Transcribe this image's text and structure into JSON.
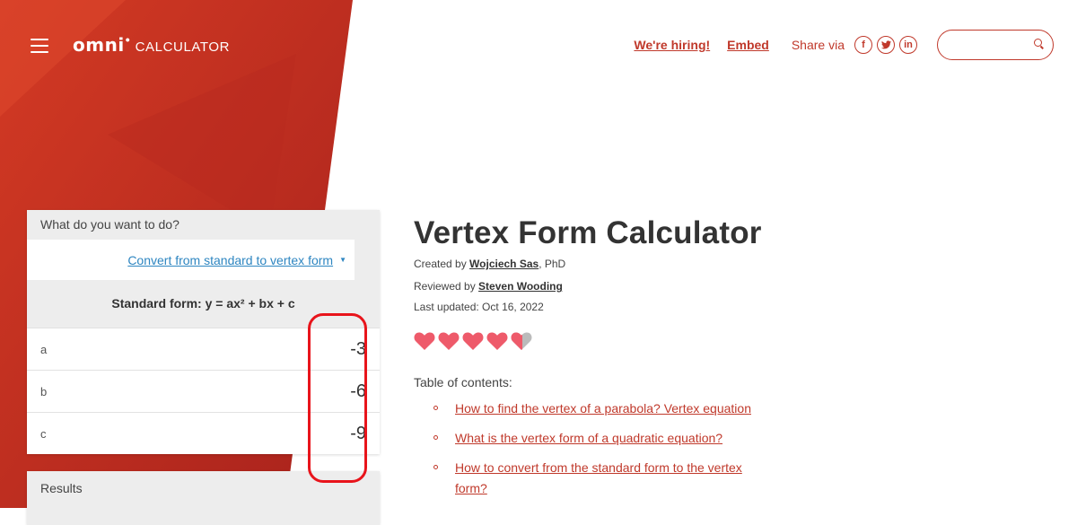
{
  "header": {
    "logo_word": "omni",
    "logo_suffix": "CALCULATOR",
    "links": [
      "We're hiring!",
      "Embed"
    ],
    "share_label": "Share via",
    "social": [
      {
        "icon": "facebook-icon",
        "glyph": "f"
      },
      {
        "icon": "twitter-icon",
        "glyph": "t"
      },
      {
        "icon": "linkedin-icon",
        "glyph": "in"
      }
    ],
    "search": {
      "value": "",
      "placeholder": ""
    }
  },
  "calculator": {
    "question": "What do you want to do?",
    "mode_selected": "Convert from standard to vertex form",
    "formula_label": "Standard form: y = ax² + bx + c",
    "inputs": [
      {
        "label": "a",
        "value": "-3"
      },
      {
        "label": "b",
        "value": "-6"
      },
      {
        "label": "c",
        "value": "-9"
      }
    ],
    "results_title": "Results"
  },
  "article": {
    "title": "Vertex Form Calculator",
    "created_prefix": "Created by",
    "author": "Wojciech Sas",
    "author_suffix": ", PhD",
    "reviewed_prefix": "Reviewed by",
    "reviewer": "Steven Wooding",
    "updated": "Last updated: Oct 16, 2022",
    "rating": 4.5,
    "toc_title": "Table of contents:",
    "toc": [
      "How to find the vertex of a parabola? Vertex equation",
      "What is the vertex form of a quadratic equation?",
      "How to convert from the standard form to the vertex form?"
    ]
  },
  "colors": {
    "brand_red": "#c0392b",
    "link_blue": "#2e86c1",
    "highlight_red": "#e8141b",
    "heart": "#ee5a6a",
    "heart_empty": "#bbbbbb"
  }
}
